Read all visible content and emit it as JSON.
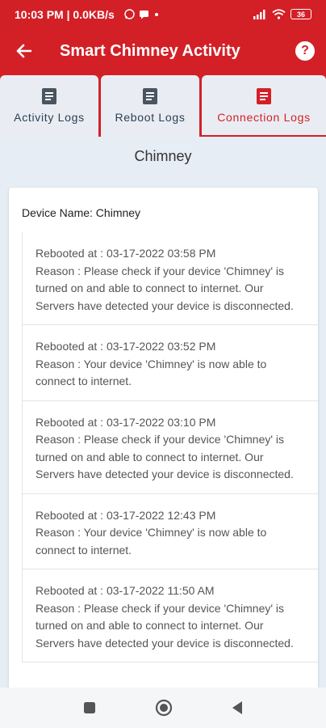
{
  "status_bar": {
    "time_info": "10:03 PM | 0.0KB/s",
    "battery": "36"
  },
  "app_bar": {
    "title": "Smart Chimney Activity"
  },
  "tabs": [
    {
      "label": "Activity Logs"
    },
    {
      "label": "Reboot Logs"
    },
    {
      "label": "Connection Logs"
    }
  ],
  "section_title": "Chimney",
  "device_name": "Device Name: Chimney",
  "logs": [
    {
      "rebooted_at": "Rebooted at : 03-17-2022 03:58 PM",
      "reason": "Reason : Please check if your device 'Chimney' is turned on and able to connect to internet. Our Servers have detected your device is disconnected."
    },
    {
      "rebooted_at": "Rebooted at : 03-17-2022 03:52 PM",
      "reason": "Reason : Your device 'Chimney' is now able to connect to internet."
    },
    {
      "rebooted_at": "Rebooted at : 03-17-2022 03:10 PM",
      "reason": "Reason : Please check if your device 'Chimney' is turned on and able to connect to internet. Our Servers have detected your device is disconnected."
    },
    {
      "rebooted_at": "Rebooted at : 03-17-2022 12:43 PM",
      "reason": "Reason : Your device 'Chimney' is now able to connect to internet."
    },
    {
      "rebooted_at": "Rebooted at : 03-17-2022 11:50 AM",
      "reason": "Reason : Please check if your device 'Chimney' is turned on and able to connect to internet. Our Servers have detected your device is disconnected."
    }
  ],
  "colors": {
    "primary": "#d32027",
    "background": "#e6edf5",
    "tab_background": "#e9edf3",
    "text": "#555555"
  },
  "icons": {
    "back": "arrow-left-icon",
    "help": "help-icon",
    "tab": "document-icon",
    "nav": [
      "recent-apps-icon",
      "home-icon",
      "back-triangle-icon"
    ]
  }
}
